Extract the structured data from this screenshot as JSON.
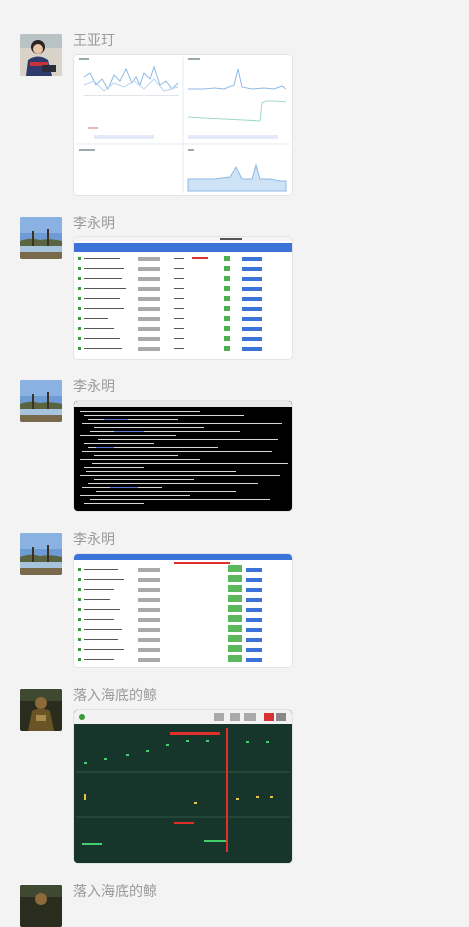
{
  "chat": {
    "messages": [
      {
        "sender": "王亚玎",
        "avatar": "avatar-person-photo",
        "content": "image-dashboard-charts"
      },
      {
        "sender": "李永明",
        "avatar": "avatar-lake-photo",
        "content": "image-table-screenshot"
      },
      {
        "sender": "李永明",
        "avatar": "avatar-lake-photo",
        "content": "image-terminal-screenshot"
      },
      {
        "sender": "李永明",
        "avatar": "avatar-lake-photo",
        "content": "image-table-screenshot"
      },
      {
        "sender": "落入海底的鲸",
        "avatar": "avatar-dark-photo",
        "content": "image-monitor-screenshot"
      },
      {
        "sender": "落入海底的鲸",
        "avatar": "avatar-dark-photo",
        "content": "image"
      }
    ]
  },
  "colors": {
    "background": "#f3f3f3",
    "sender_text": "#9a9a9a",
    "table_header": "#3b73d9",
    "terminal_bg": "#000000",
    "monitor_bg": "#17352a",
    "alert_red": "#e0302b"
  }
}
